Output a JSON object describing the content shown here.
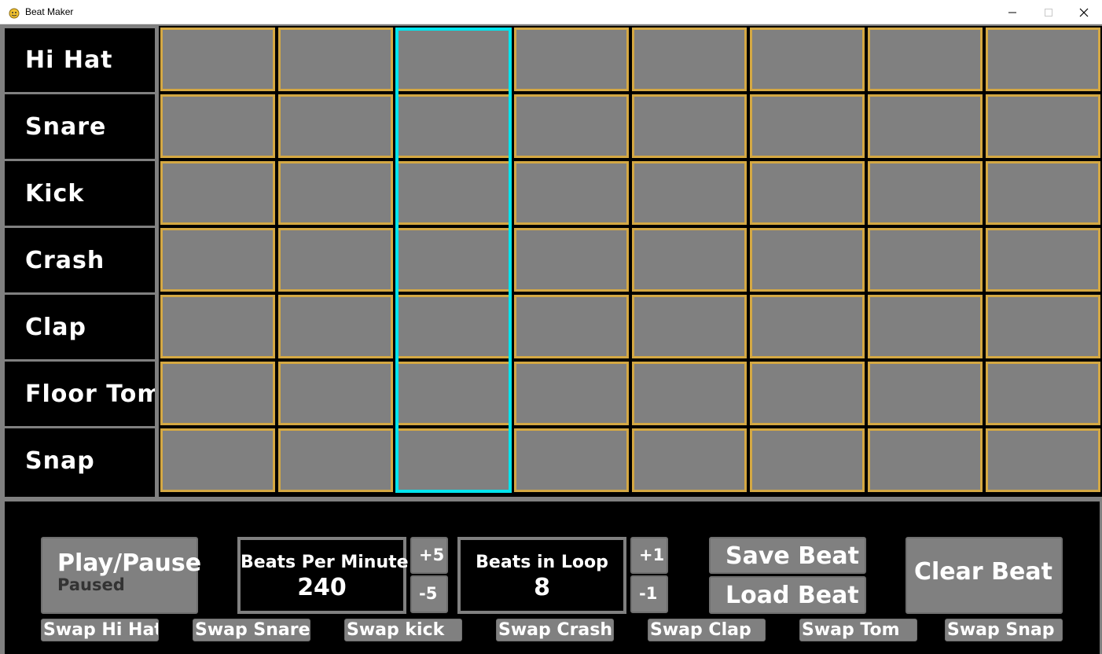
{
  "window": {
    "title": "Beat Maker"
  },
  "colors": {
    "cell": "#808080",
    "cell_border": "#d4a843",
    "playhead": "#00e5ee",
    "background": "#000000",
    "frame": "#808080"
  },
  "instruments": [
    "Hi Hat",
    "Snare",
    "Kick",
    "Crash",
    "Clap",
    "Floor Tom",
    "Snap"
  ],
  "beats": 8,
  "active_beat_index": 2,
  "controls": {
    "play_pause": {
      "label": "Play/Pause",
      "status": "Paused"
    },
    "bpm": {
      "label": "Beats Per Minute",
      "value": "240",
      "plus": "+5",
      "minus": "-5"
    },
    "loop": {
      "label": "Beats in Loop",
      "value": "8",
      "plus": "+1",
      "minus": "-1"
    },
    "save": "Save Beat",
    "load": "Load Beat",
    "clear": "Clear Beat"
  },
  "swap_buttons": [
    "Swap Hi Hat",
    "Swap Snare",
    "Swap kick",
    "Swap Crash",
    "Swap Clap",
    "Swap Tom",
    "Swap Snap"
  ]
}
